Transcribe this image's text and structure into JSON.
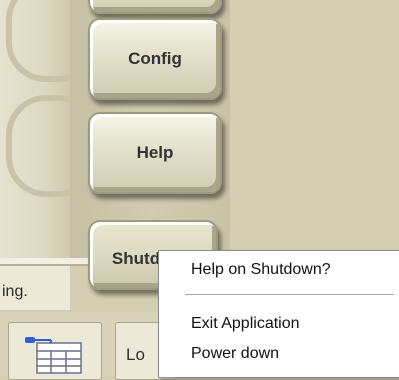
{
  "buttons": {
    "config": "Config",
    "help": "Help",
    "shutdown": "Shutdown"
  },
  "status": {
    "text": "ing."
  },
  "context_menu": {
    "items": [
      {
        "label": "Help on Shutdown?"
      },
      {
        "label": "Exit Application"
      },
      {
        "label": "Power down"
      }
    ]
  },
  "toolbar": {
    "lo_label": "Lo"
  },
  "icons": {
    "toolbar_icon": "grid-table-icon"
  }
}
